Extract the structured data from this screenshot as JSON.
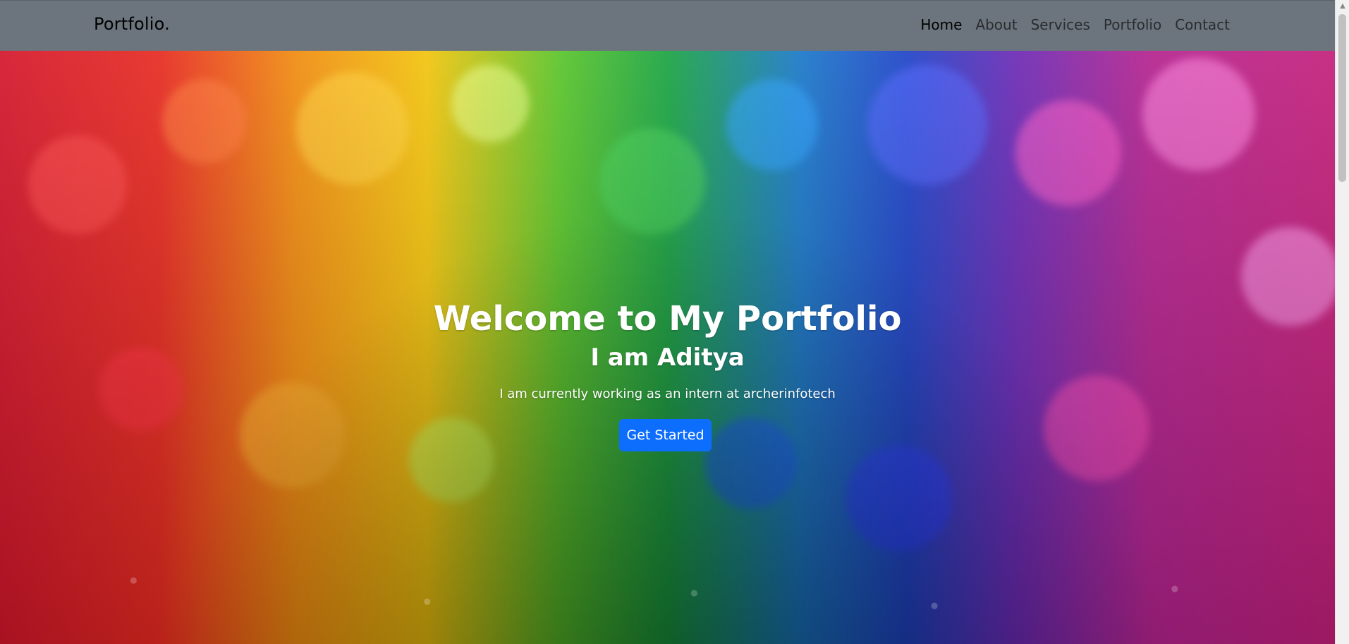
{
  "navbar": {
    "brand": "Portfolio.",
    "links": [
      {
        "label": "Home",
        "active": true
      },
      {
        "label": "About",
        "active": false
      },
      {
        "label": "Services",
        "active": false
      },
      {
        "label": "Portfolio",
        "active": false
      },
      {
        "label": "Contact",
        "active": false
      }
    ]
  },
  "hero": {
    "title": "Welcome to My Portfolio",
    "subtitle": "I am Aditya",
    "text": "I am currently working as an intern at archerinfotech",
    "button_label": "Get Started"
  },
  "colors": {
    "navbar_bg": "#6c757d",
    "button_bg": "#0d6efd"
  }
}
